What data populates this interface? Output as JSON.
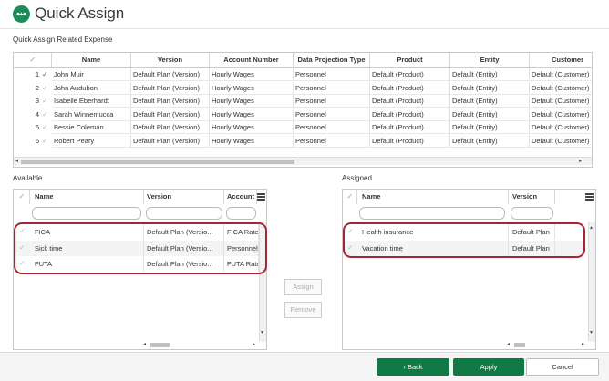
{
  "header": {
    "title": "Quick Assign"
  },
  "top_grid": {
    "section_label": "Quick Assign Related Expense",
    "columns": [
      "Name",
      "Version",
      "Account Number",
      "Data Projection Type",
      "Product",
      "Entity",
      "Customer"
    ],
    "rows": [
      {
        "num": "1",
        "cells": [
          "John Muir",
          "Default Plan (Version)",
          "Hourly Wages",
          "Personnel",
          "Default (Product)",
          "Default (Entity)",
          "Default (Customer)"
        ]
      },
      {
        "num": "2",
        "cells": [
          "John Audubon",
          "Default Plan (Version)",
          "Hourly Wages",
          "Personnel",
          "Default (Product)",
          "Default (Entity)",
          "Default (Customer)"
        ]
      },
      {
        "num": "3",
        "cells": [
          "Isabelle Eberhardt",
          "Default Plan (Version)",
          "Hourly Wages",
          "Personnel",
          "Default (Product)",
          "Default (Entity)",
          "Default (Customer)"
        ]
      },
      {
        "num": "4",
        "cells": [
          "Sarah Winnemucca",
          "Default Plan (Version)",
          "Hourly Wages",
          "Personnel",
          "Default (Product)",
          "Default (Entity)",
          "Default (Customer)"
        ]
      },
      {
        "num": "5",
        "cells": [
          "Bessie Coleman",
          "Default Plan (Version)",
          "Hourly Wages",
          "Personnel",
          "Default (Product)",
          "Default (Entity)",
          "Default (Customer)"
        ]
      },
      {
        "num": "6",
        "cells": [
          "Robert Peary",
          "Default Plan (Version)",
          "Hourly Wages",
          "Personnel",
          "Default (Product)",
          "Default (Entity)",
          "Default (Customer)"
        ]
      }
    ]
  },
  "available": {
    "section_label": "Available",
    "columns": [
      "Name",
      "Version",
      "Account N"
    ],
    "rows": [
      [
        "FICA",
        "Default Plan (Versio...",
        "FICA Rate"
      ],
      [
        "Sick time",
        "Default Plan (Versio...",
        "Personnel"
      ],
      [
        "FUTA",
        "Default Plan (Versio...",
        "FUTA Rate"
      ]
    ]
  },
  "assigned": {
    "section_label": "Assigned",
    "columns": [
      "Name",
      "Version"
    ],
    "rows": [
      [
        "Health insurance",
        "Default Plan"
      ],
      [
        "Vacation time",
        "Default Plan"
      ]
    ]
  },
  "middle": {
    "assign_label": "Assign",
    "remove_label": "Remove"
  },
  "footer": {
    "back_label": "Back",
    "apply_label": "Apply",
    "cancel_label": "Cancel"
  },
  "colors": {
    "brand_green": "#107a47",
    "highlight_red": "#a42634"
  },
  "icons": [
    "app-logo-icon",
    "checkmark-icon",
    "menu-icon",
    "chevron-left-icon"
  ]
}
